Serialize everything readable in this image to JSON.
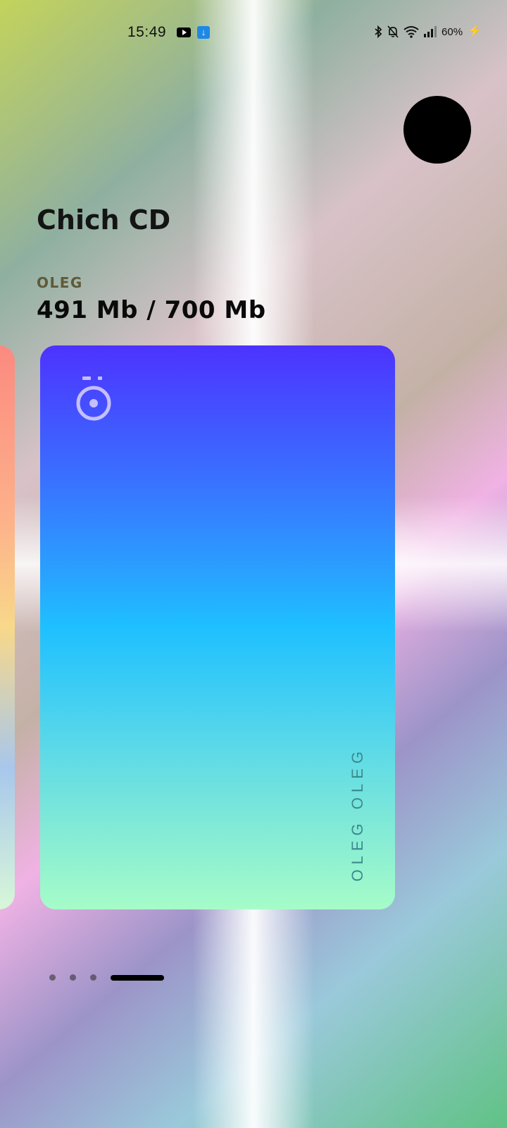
{
  "status_bar": {
    "time": "15:49",
    "battery": "60%",
    "notification_icons": [
      "youtube-icon",
      "usb-icon"
    ],
    "system_icons": [
      "bluetooth-icon",
      "bell-off-icon",
      "wifi-icon",
      "signal-icon",
      "battery-charging-icon"
    ]
  },
  "header": {
    "title": "Chich CD"
  },
  "account": {
    "owner": "OLEG",
    "usage": "491 Mb / 700 Mb"
  },
  "card": {
    "holder_name": "OLEG OLEG",
    "logo_icon": "ring-dot-icon"
  },
  "pager": {
    "total": 4,
    "active_index": 3
  }
}
